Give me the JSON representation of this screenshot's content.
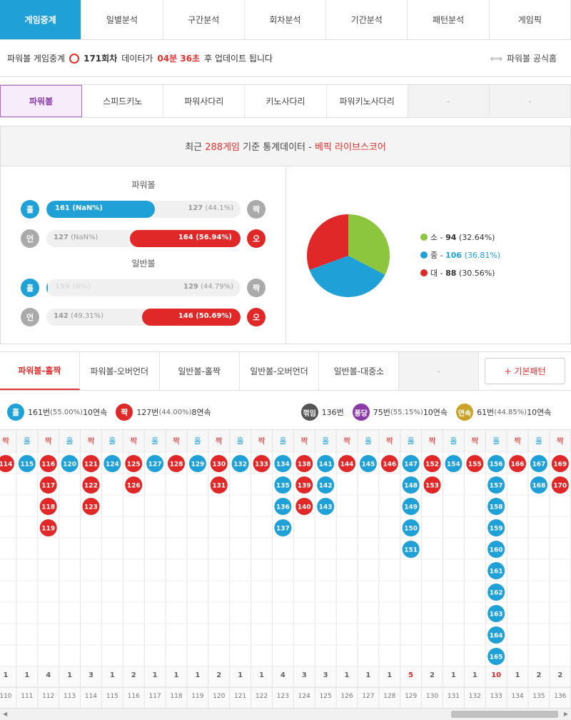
{
  "topnav": [
    "게임중계",
    "일별분석",
    "구간분석",
    "회차분석",
    "기간분석",
    "패턴분석",
    "게임픽"
  ],
  "info": {
    "prefix": "파워볼 게임중계",
    "round": "171회차",
    "mid": "데이터가",
    "time": "04분 36초",
    "suffix": "후 업데이트 됩니다",
    "official": "파워볼 공식홈"
  },
  "gametabs": [
    "파워볼",
    "스피드키노",
    "파워사다리",
    "키노사다리",
    "파워키노사다리",
    "-",
    "-"
  ],
  "stats": {
    "head_a": "최근",
    "head_count": "288게임",
    "head_b": "기준 통계데이터 -",
    "head_src": "베픽 라이브스코어",
    "powerball_title": "파워볼",
    "normal_title": "일반볼",
    "rows": [
      {
        "lc": "홀",
        "rc": "짝",
        "ltext": "161 (NaN%)",
        "rtext": "127",
        "rpct": "(44.1%)",
        "side": "L",
        "frac": 0.559
      },
      {
        "lc": "언",
        "rc": "오",
        "ltext": "127",
        "lpct": "(NaN%)",
        "rtext": "164 (56.94%)",
        "side": "R",
        "frac": 0.569
      },
      {
        "lc": "홀",
        "rc": "짝",
        "ltext": "159 (0%)",
        "rtext": "129",
        "rpct": "(44.79%)",
        "side": "L",
        "frac": 0.0
      },
      {
        "lc": "언",
        "rc": "오",
        "ltext": "142",
        "lpct": "(49.31%)",
        "rtext": "146 (50.69%)",
        "side": "R",
        "frac": 0.507
      }
    ],
    "pie": [
      {
        "label": "소",
        "count": "94",
        "pct": "(32.64%)",
        "value": 94,
        "color": "#8cc63f"
      },
      {
        "label": "중",
        "count": "106",
        "pct": "(36.81%)",
        "value": 106,
        "color": "#1fa0d7"
      },
      {
        "label": "대",
        "count": "88",
        "pct": "(30.56%)",
        "value": 88,
        "color": "#e02828"
      }
    ]
  },
  "pattabs": [
    "파워볼-홀짝",
    "파워볼-오버언더",
    "일반볼-홀짝",
    "일반볼-오버언더",
    "일반볼-대중소",
    "-",
    "+ 기본패턴"
  ],
  "summary": [
    {
      "icon": "홀",
      "color": "#1fa0d7",
      "text": "161번",
      "pct": "(55.00%)",
      "streak": "10연속"
    },
    {
      "icon": "짝",
      "color": "#e02828",
      "text": "127번",
      "pct": "(44.00%)",
      "streak": "8연속"
    },
    {
      "icon": "꺾임",
      "color": "#555555",
      "text": "136번",
      "pct": "",
      "streak": ""
    },
    {
      "icon": "퐁당",
      "color": "#8b3aa8",
      "text": "75번",
      "pct": "(55.15%)",
      "streak": "10연속"
    },
    {
      "icon": "연속",
      "color": "#c9a227",
      "text": "61번",
      "pct": "(44.85%)",
      "streak": "10연속"
    }
  ],
  "grid": {
    "cols": [
      {
        "h": "짝",
        "c": "r",
        "v": [
          "114"
        ],
        "cnt": "1",
        "rd": "110"
      },
      {
        "h": "홀",
        "c": "b",
        "v": [
          "115"
        ],
        "cnt": "1",
        "rd": "111"
      },
      {
        "h": "짝",
        "c": "r",
        "v": [
          "116",
          "117",
          "118",
          "119"
        ],
        "cnt": "4",
        "rd": "112"
      },
      {
        "h": "홀",
        "c": "b",
        "v": [
          "120"
        ],
        "cnt": "1",
        "rd": "113"
      },
      {
        "h": "짝",
        "c": "r",
        "v": [
          "121",
          "122",
          "123"
        ],
        "cnt": "3",
        "rd": "114"
      },
      {
        "h": "홀",
        "c": "b",
        "v": [
          "124"
        ],
        "cnt": "1",
        "rd": "115"
      },
      {
        "h": "짝",
        "c": "r",
        "v": [
          "125",
          "126"
        ],
        "cnt": "2",
        "rd": "116"
      },
      {
        "h": "홀",
        "c": "b",
        "v": [
          "127"
        ],
        "cnt": "1",
        "rd": "117"
      },
      {
        "h": "짝",
        "c": "r",
        "v": [
          "128"
        ],
        "cnt": "1",
        "rd": "118"
      },
      {
        "h": "홀",
        "c": "b",
        "v": [
          "129"
        ],
        "cnt": "1",
        "rd": "119"
      },
      {
        "h": "짝",
        "c": "r",
        "v": [
          "130",
          "131"
        ],
        "cnt": "2",
        "rd": "120"
      },
      {
        "h": "홀",
        "c": "b",
        "v": [
          "132"
        ],
        "cnt": "1",
        "rd": "121"
      },
      {
        "h": "짝",
        "c": "r",
        "v": [
          "133"
        ],
        "cnt": "1",
        "rd": "122"
      },
      {
        "h": "홀",
        "c": "b",
        "v": [
          "134",
          "135",
          "136",
          "137"
        ],
        "cnt": "4",
        "rd": "123"
      },
      {
        "h": "짝",
        "c": "r",
        "v": [
          "138",
          "139",
          "140"
        ],
        "cnt": "3",
        "rd": "124"
      },
      {
        "h": "홀",
        "c": "b",
        "v": [
          "141",
          "142",
          "143"
        ],
        "cnt": "3",
        "rd": "125"
      },
      {
        "h": "짝",
        "c": "r",
        "v": [
          "144"
        ],
        "cnt": "1",
        "rd": "126"
      },
      {
        "h": "홀",
        "c": "b",
        "v": [
          "145"
        ],
        "cnt": "1",
        "rd": "127"
      },
      {
        "h": "짝",
        "c": "r",
        "v": [
          "146"
        ],
        "cnt": "1",
        "rd": "128"
      },
      {
        "h": "홀",
        "c": "b",
        "v": [
          "147",
          "148",
          "149",
          "150",
          "151"
        ],
        "cnt": "5",
        "rd": "129",
        "hl": true
      },
      {
        "h": "짝",
        "c": "r",
        "v": [
          "152",
          "153"
        ],
        "cnt": "2",
        "rd": "130"
      },
      {
        "h": "홀",
        "c": "b",
        "v": [
          "154"
        ],
        "cnt": "1",
        "rd": "131"
      },
      {
        "h": "짝",
        "c": "r",
        "v": [
          "155"
        ],
        "cnt": "1",
        "rd": "132"
      },
      {
        "h": "홀",
        "c": "b",
        "v": [
          "156",
          "157",
          "158",
          "159",
          "160",
          "161",
          "162",
          "163",
          "164",
          "165"
        ],
        "cnt": "10",
        "rd": "133",
        "hl": true
      },
      {
        "h": "짝",
        "c": "r",
        "v": [
          "166"
        ],
        "cnt": "1",
        "rd": "134"
      },
      {
        "h": "홀",
        "c": "b",
        "v": [
          "167",
          "168"
        ],
        "cnt": "2",
        "rd": "135"
      },
      {
        "h": "짝",
        "c": "r",
        "v": [
          "169",
          "170"
        ],
        "cnt": "2",
        "rd": "136"
      }
    ]
  }
}
